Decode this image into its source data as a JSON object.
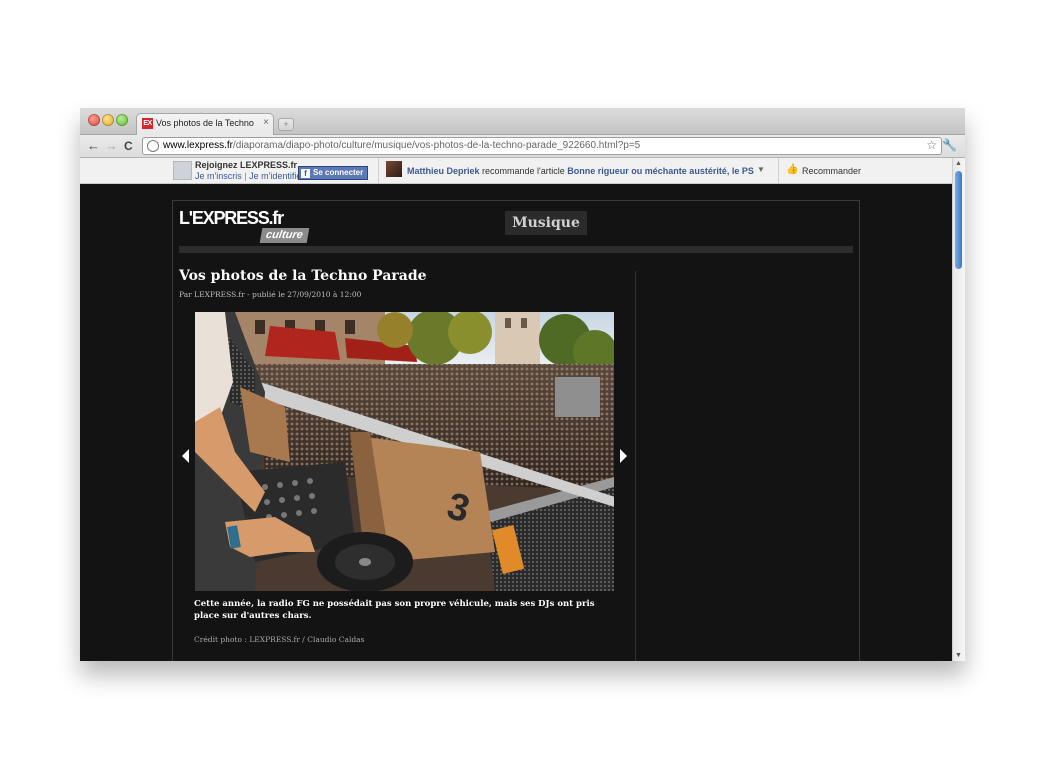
{
  "browser": {
    "tab_title": "Vos photos de la Techno Parade",
    "favicon_text": "EX",
    "url_host": "www.lexpress.fr",
    "url_path": "/diaporama/diapo-photo/culture/musique/vos-photos-de-la-techno-parade_922660.html?p=5",
    "back_glyph": "←",
    "forward_glyph": "→",
    "reload_glyph": "C"
  },
  "facebook_bar": {
    "join_text": "Rejoignez LEXPRESS.fr",
    "signup_link": "Je m'inscris",
    "separator": "|",
    "login_link": "Je m'identifie",
    "connect_button": "Se connecter",
    "friend_name": "Matthieu Depriek",
    "reco_verb": "recommande l'article",
    "reco_article": "Bonne rigueur ou méchante austérité, le PS",
    "recommend_label": "Recommander"
  },
  "site": {
    "logo_main": "L'EXPRESS.fr",
    "logo_sub": "culture",
    "section_label": "Musique"
  },
  "article": {
    "title": "Vos photos de la Techno Parade",
    "byline": "Par LEXPRESS.fr - publié le 27/09/2010 à 12:00",
    "caption": "Cette année, la radio FG ne possédait pas son propre véhicule, mais ses DJs ont pris place sur d'autres chars.",
    "credit": "Crédit photo : LEXPRESS.fr / Claudio Caldas",
    "disc_label": "3"
  },
  "icons": {
    "close": "×",
    "new_tab": "+",
    "star": "☆",
    "wrench": "🔧",
    "dropdown": "▼",
    "like": "👍",
    "facebook_f": "f",
    "scroll_up": "▲",
    "scroll_down": "▼"
  },
  "colors": {
    "page_bg": "#141314",
    "facebook_blue": "#3b5998",
    "logo_red": "#d9262b",
    "scroll_thumb": "#3c79cc"
  }
}
